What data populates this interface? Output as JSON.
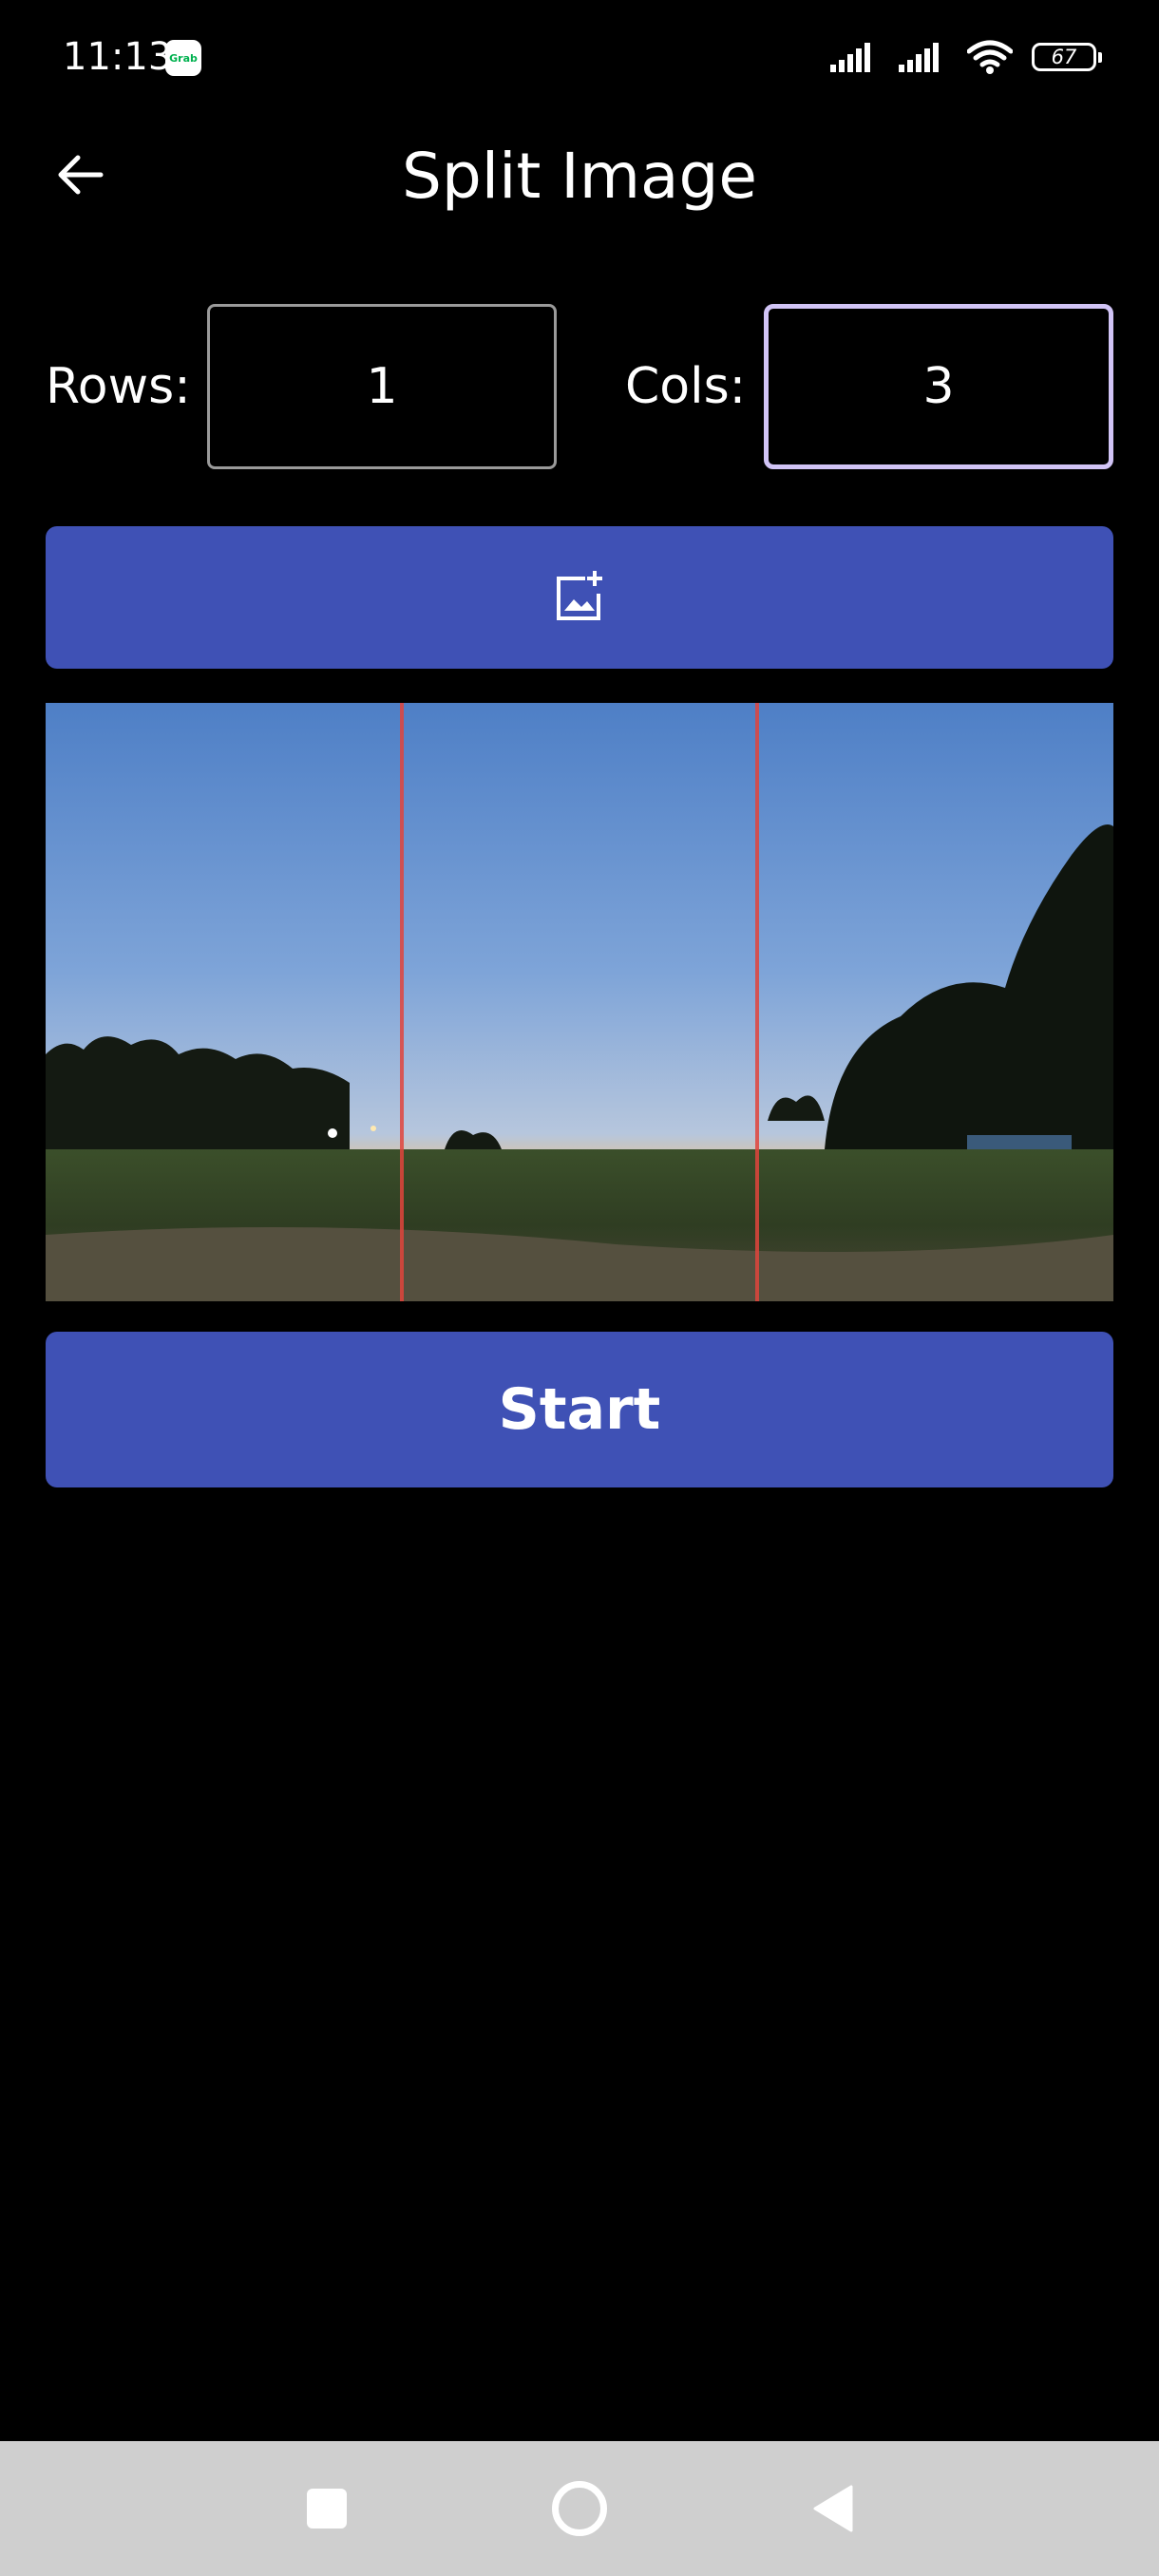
{
  "status_bar": {
    "time": "11:13",
    "notification_app": "Grab",
    "battery_level": "67",
    "icons": [
      "signal-icon",
      "signal-icon",
      "wifi-icon",
      "battery-icon"
    ]
  },
  "app_bar": {
    "title": "Split Image",
    "back_icon": "arrow-left-icon"
  },
  "grid_settings": {
    "rows_label": "Rows:",
    "rows_value": "1",
    "cols_label": "Cols:",
    "cols_value": "3",
    "focused_field": "cols"
  },
  "add_image_button": {
    "icon": "add-photo-icon"
  },
  "preview": {
    "description_icon": "sunset-photo",
    "split_columns": 3,
    "split_line_color": "#e0443c"
  },
  "start_button": {
    "label": "Start"
  },
  "nav_bar": {
    "buttons": [
      "recents-icon",
      "home-icon",
      "back-triangle-icon"
    ]
  },
  "colors": {
    "background": "#000000",
    "accent": "#3f51b5",
    "focus_border": "#d1c4f6",
    "nav_background": "#cfcfcf"
  }
}
